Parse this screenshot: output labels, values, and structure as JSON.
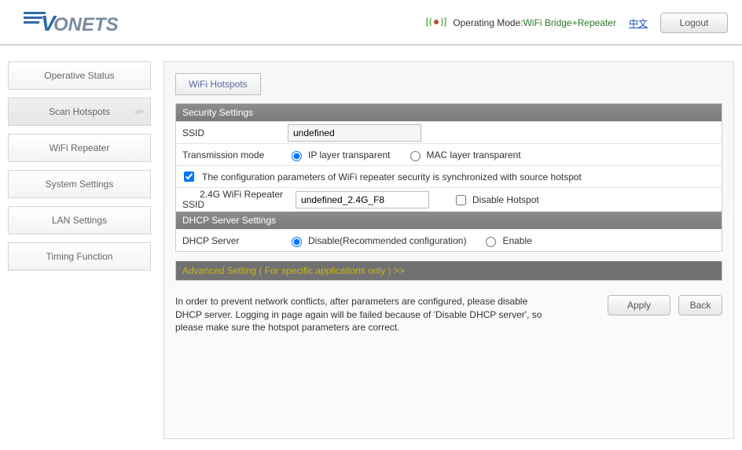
{
  "header": {
    "op_mode_label": "Operating Mode:",
    "op_mode_value": "WiFi Bridge+Repeater",
    "lang_link": "中文",
    "logout": "Logout"
  },
  "sidebar": {
    "items": [
      {
        "label": "Operative Status"
      },
      {
        "label": "Scan Hotspots"
      },
      {
        "label": "WiFi Repeater"
      },
      {
        "label": "System Settings"
      },
      {
        "label": "LAN Settings"
      },
      {
        "label": "Timing Function"
      }
    ]
  },
  "tab": {
    "wifi_hotspots": "WiFi Hotspots"
  },
  "sec": {
    "head": "Security Settings",
    "ssid_label": "SSID",
    "ssid_value": "undefined",
    "trans_label": "Transmission mode",
    "trans_opt1": "IP layer transparent",
    "trans_opt2": "MAC layer transparent",
    "sync_text": "The configuration parameters of WiFi repeater security is synchronized with source hotspot",
    "repeater_ssid_line1": "2.4G WiFi Repeater",
    "repeater_ssid_line2": "SSID",
    "repeater_ssid_value": "undefined_2.4G_F8",
    "disable_hotspot": "Disable Hotspot"
  },
  "dhcp": {
    "head": "DHCP Server Settings",
    "label": "DHCP Server",
    "opt1": "Disable(Recommended configuration)",
    "opt2": "Enable"
  },
  "adv": {
    "text": "Advanced Setting ( For specific applications only ) >>"
  },
  "note": "In order to prevent network conflicts, after parameters are configured, please disable DHCP server. Logging in page again will be failed because of 'Disable DHCP server', so please make sure the hotspot parameters are correct.",
  "buttons": {
    "apply": "Apply",
    "back": "Back"
  }
}
